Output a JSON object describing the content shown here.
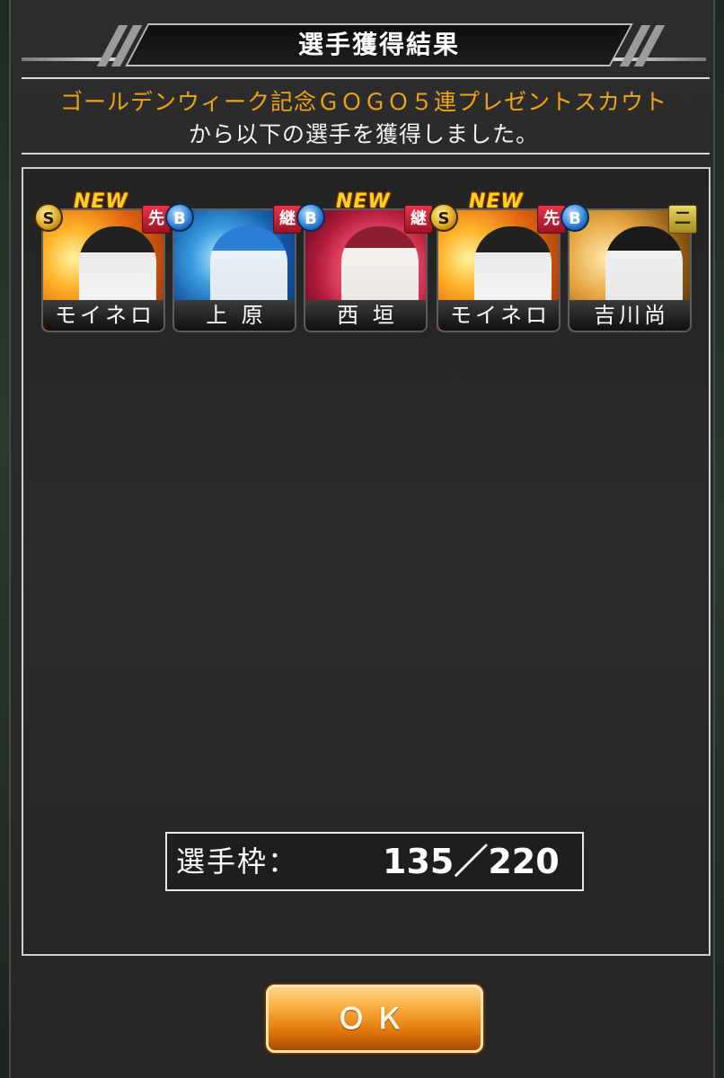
{
  "dialog": {
    "title": "選手獲得結果",
    "scout_name": "ゴールデンウィーク記念ＧＯＧＯ５連プレゼントスカウト",
    "message": "から以下の選手を獲得しました。"
  },
  "players": [
    {
      "name": "モイネロ",
      "rank": "S",
      "position": "先",
      "new_label": "NEW"
    },
    {
      "name": "上 原",
      "rank": "B",
      "position": "継",
      "new_label": ""
    },
    {
      "name": "西 垣",
      "rank": "B",
      "position": "継",
      "new_label": "NEW"
    },
    {
      "name": "モイネロ",
      "rank": "S",
      "position": "先",
      "new_label": "NEW"
    },
    {
      "name": "吉川尚",
      "rank": "B",
      "position": "二",
      "new_label": ""
    }
  ],
  "capacity": {
    "label": "選手枠：",
    "value": "135／220"
  },
  "buttons": {
    "ok_label": "ＯＫ"
  },
  "colors": {
    "scout_name": "#f0a414",
    "ok_button": "#f7a93a"
  }
}
